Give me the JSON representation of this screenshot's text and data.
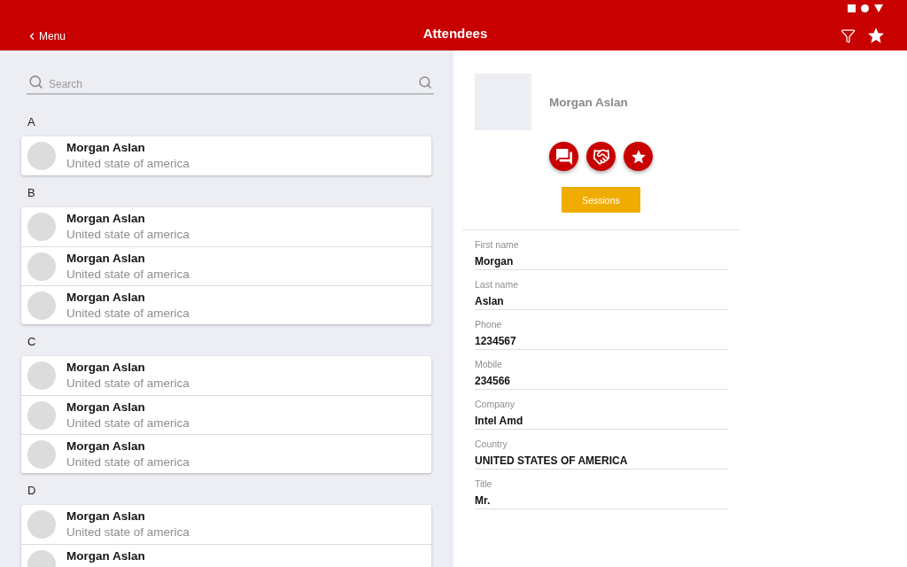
{
  "header": {
    "back_label": "Menu",
    "title": "Attendees"
  },
  "search": {
    "placeholder": "Search"
  },
  "sections": [
    {
      "letter": "A",
      "attendees": [
        {
          "name": "Morgan Aslan",
          "country": "United state of america"
        }
      ]
    },
    {
      "letter": "B",
      "attendees": [
        {
          "name": "Morgan Aslan",
          "country": "United state of america"
        },
        {
          "name": "Morgan Aslan",
          "country": "United state of america"
        },
        {
          "name": "Morgan Aslan",
          "country": "United state of america"
        }
      ]
    },
    {
      "letter": "C",
      "attendees": [
        {
          "name": "Morgan Aslan",
          "country": "United state of america"
        },
        {
          "name": "Morgan Aslan",
          "country": "United state of america"
        },
        {
          "name": "Morgan Aslan",
          "country": "United state of america"
        }
      ]
    },
    {
      "letter": "D",
      "attendees": [
        {
          "name": "Morgan Aslan",
          "country": "United state of america"
        },
        {
          "name": "Morgan Aslan"
        }
      ]
    }
  ],
  "detail": {
    "name": "Morgan Aslan",
    "actions": [
      {
        "kind": "chat"
      },
      {
        "kind": "handshake"
      },
      {
        "kind": "favorite"
      }
    ],
    "sessions_label": "Sessions",
    "fields": [
      {
        "label": "First name",
        "value": "Morgan"
      },
      {
        "label": "Last name",
        "value": "Aslan"
      },
      {
        "label": "Phone",
        "value": "1234567"
      },
      {
        "label": "Mobile",
        "value": "234566"
      },
      {
        "label": "Company",
        "value": "Intel Amd"
      },
      {
        "label": "Country",
        "value": "UNITED STATES OF AMERICA"
      },
      {
        "label": "Title",
        "value": "Mr."
      }
    ]
  }
}
